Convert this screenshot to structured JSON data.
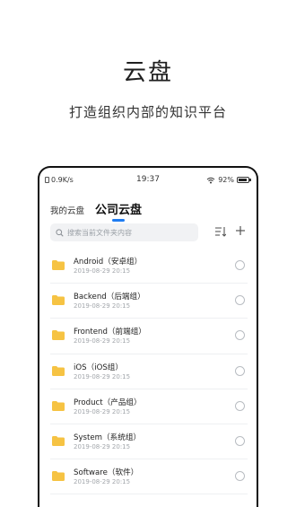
{
  "hero": {
    "title": "云盘",
    "subtitle": "打造组织内部的知识平台"
  },
  "status_bar": {
    "speed": "0.9K/s",
    "time": "19:37",
    "battery": "92%"
  },
  "tabs": {
    "inactive": "我的云盘",
    "active": "公司云盘"
  },
  "search": {
    "placeholder": "搜索当前文件夹内容"
  },
  "files": [
    {
      "name": "Android（安卓组）",
      "date": "2019-08-29 20:15"
    },
    {
      "name": "Backend（后端组）",
      "date": "2019-08-29 20:15"
    },
    {
      "name": "Frontend（前端组）",
      "date": "2019-08-29 20:15"
    },
    {
      "name": "iOS（iOS组）",
      "date": "2019-08-29 20:15"
    },
    {
      "name": "Product（产品组）",
      "date": "2019-08-29 20:15"
    },
    {
      "name": "System（系统组）",
      "date": "2019-08-29 20:15"
    },
    {
      "name": "Software（软件）",
      "date": "2019-08-29 20:15"
    }
  ],
  "colors": {
    "accent": "#1e7cf2",
    "folder": "#f6c343"
  }
}
